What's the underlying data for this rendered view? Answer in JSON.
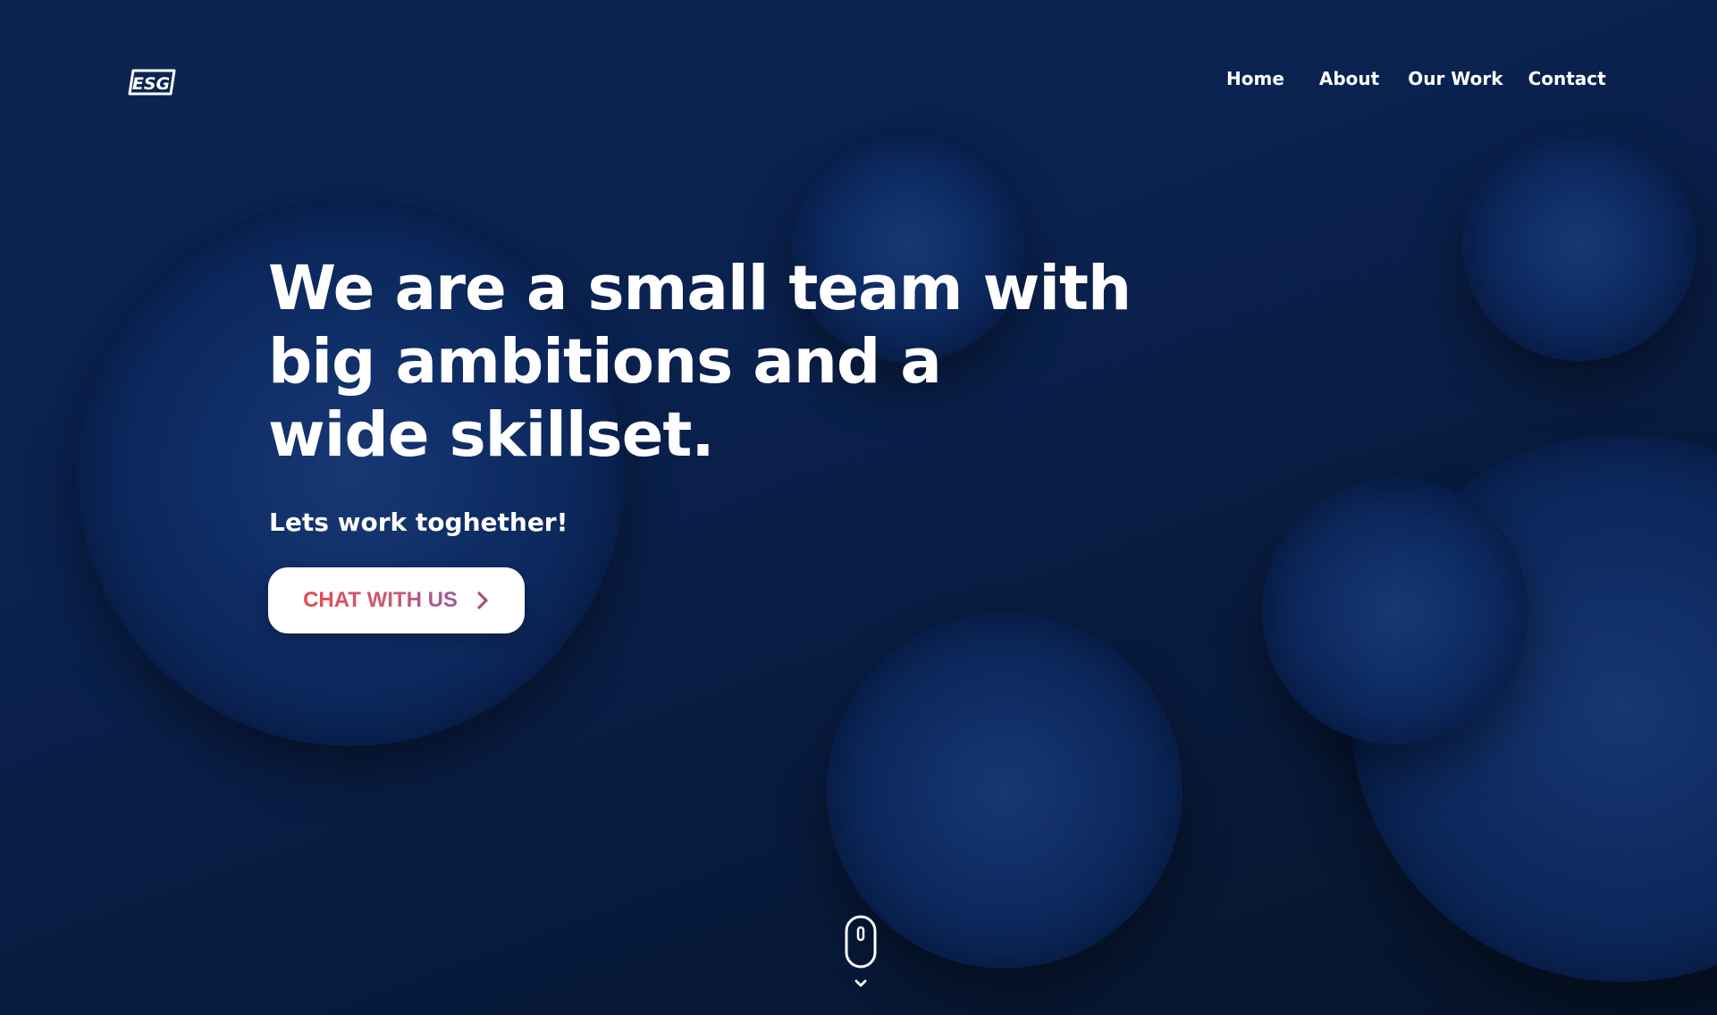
{
  "brand": {
    "logo_text": "ESG",
    "logo_icon": "esg-logo"
  },
  "nav": {
    "items": [
      {
        "label": "Home"
      },
      {
        "label": "About"
      },
      {
        "label": "Our Work"
      },
      {
        "label": "Contact"
      }
    ]
  },
  "hero": {
    "title_lines": [
      "We are a small team with",
      "big ambitions and a",
      "wide skillset."
    ],
    "subtitle": "Lets work toghether!",
    "cta_label": "CHAT WITH US",
    "cta_icon": "chevron-right-icon"
  },
  "scroll_indicator": {
    "icon": "mouse-icon",
    "arrow_icon": "chevron-down-icon"
  },
  "colors": {
    "background": "#0a2250",
    "bubble": "#0f2e66",
    "text": "#ffffff",
    "cta_gradient_start": "#e8484a",
    "cta_gradient_end": "#9a5a9a"
  }
}
